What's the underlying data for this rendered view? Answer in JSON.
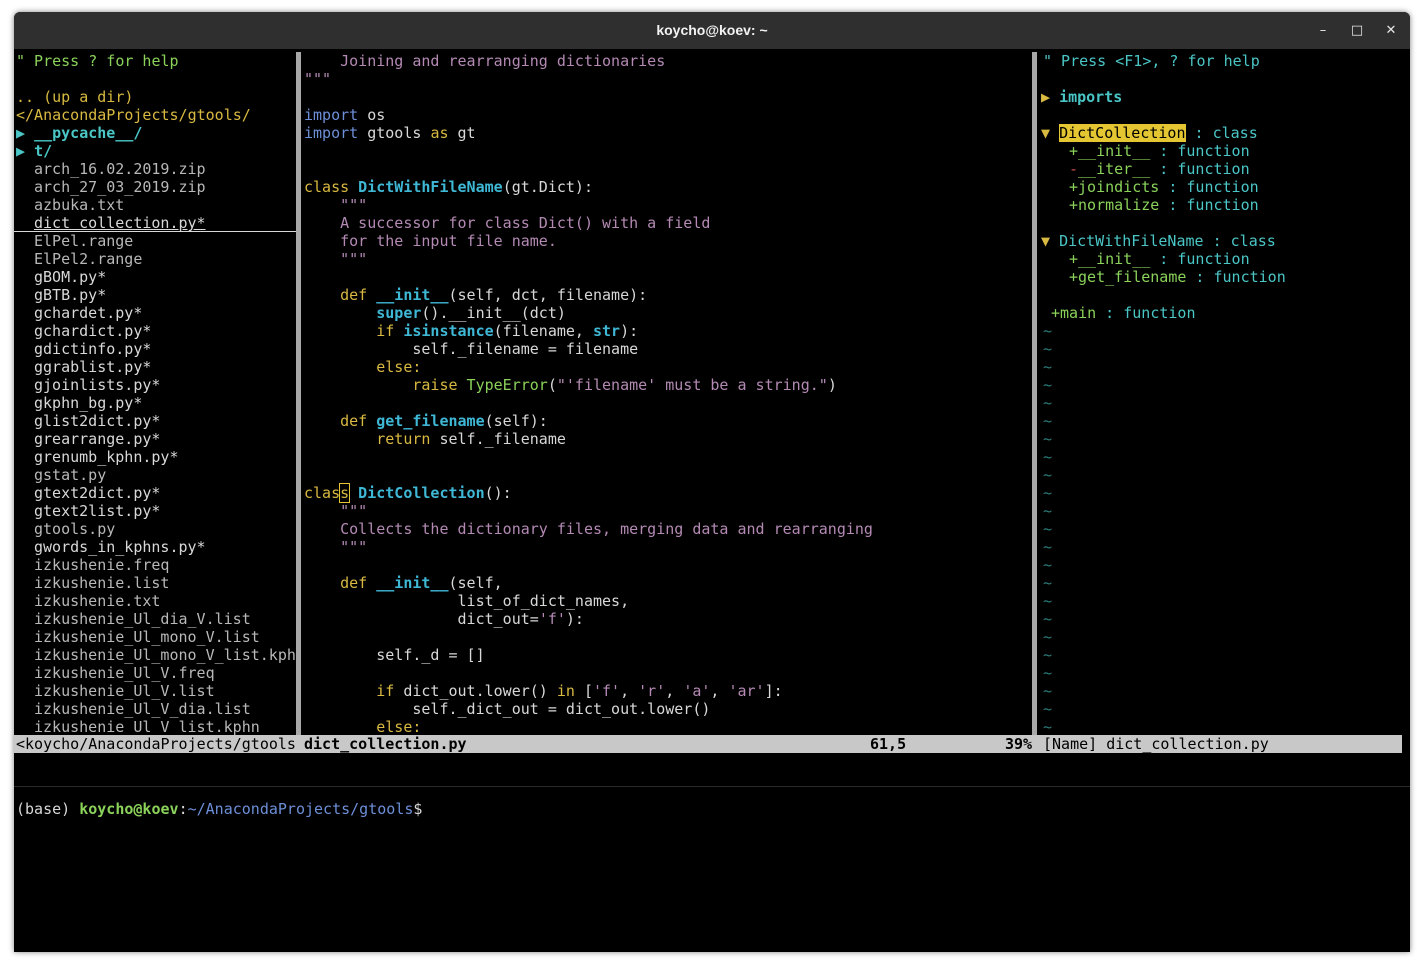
{
  "window": {
    "title": "koycho@koev: ~"
  },
  "left_pane": {
    "help": "\" Press ? for help",
    "updir": ".. (up a dir)",
    "cwd": "</AnacondaProjects/gtools/",
    "dirs": [
      "▶ __pycache__/",
      "▶ t/"
    ],
    "files": [
      {
        "name": "arch_16.02.2019.zip",
        "kind": "plain"
      },
      {
        "name": "arch_27_03_2019.zip",
        "kind": "plain"
      },
      {
        "name": "azbuka.txt",
        "kind": "plain"
      },
      {
        "name": "dict_collection.py*",
        "kind": "exec-current"
      },
      {
        "name": "ElPel.range",
        "kind": "plain"
      },
      {
        "name": "ElPel2.range",
        "kind": "plain"
      },
      {
        "name": "gBOM.py*",
        "kind": "exec"
      },
      {
        "name": "gBTB.py*",
        "kind": "exec"
      },
      {
        "name": "gchardet.py*",
        "kind": "exec"
      },
      {
        "name": "gchardict.py*",
        "kind": "exec"
      },
      {
        "name": "gdictinfo.py*",
        "kind": "exec"
      },
      {
        "name": "ggrablist.py*",
        "kind": "exec"
      },
      {
        "name": "gjoinlists.py*",
        "kind": "exec"
      },
      {
        "name": "gkphn_bg.py*",
        "kind": "exec"
      },
      {
        "name": "glist2dict.py*",
        "kind": "exec"
      },
      {
        "name": "grearrange.py*",
        "kind": "exec"
      },
      {
        "name": "grenumb_kphn.py*",
        "kind": "exec"
      },
      {
        "name": "gstat.py",
        "kind": "plain"
      },
      {
        "name": "gtext2dict.py*",
        "kind": "exec"
      },
      {
        "name": "gtext2list.py*",
        "kind": "exec"
      },
      {
        "name": "gtools.py",
        "kind": "plain"
      },
      {
        "name": "gwords_in_kphns.py*",
        "kind": "exec"
      },
      {
        "name": "izkushenie.freq",
        "kind": "plain"
      },
      {
        "name": "izkushenie.list",
        "kind": "plain"
      },
      {
        "name": "izkushenie.txt",
        "kind": "plain"
      },
      {
        "name": "izkushenie_Ul_dia_V.list",
        "kind": "plain"
      },
      {
        "name": "izkushenie_Ul_mono_V.list",
        "kind": "plain"
      },
      {
        "name": "izkushenie_Ul_mono_V_list.kph",
        "kind": "plain"
      },
      {
        "name": "izkushenie_Ul_V.freq",
        "kind": "plain"
      },
      {
        "name": "izkushenie_Ul_V.list",
        "kind": "plain"
      },
      {
        "name": "izkushenie_Ul_V_dia.list",
        "kind": "plain"
      },
      {
        "name": "izkushenie_Ul_V_list.kphn",
        "kind": "plain"
      }
    ]
  },
  "code": {
    "l1": "    Joining and rearranging dictionaries",
    "l2": "\"\"\"",
    "import1_kw": "import",
    "import1_mod": " os",
    "import2_kw": "import",
    "import2_mod": " gtools ",
    "import2_as": "as",
    "import2_alias": " gt",
    "c1_kw": "class",
    "c1_name": " DictWithFileName",
    "c1_args": "(gt.Dict):",
    "c1_doc1": "    \"\"\"",
    "c1_doc2": "    A successor for class Dict() with a field",
    "c1_doc3": "    for the input file name.",
    "c1_doc4": "    \"\"\"",
    "d1_kw": "    def",
    "d1_name": " __init__",
    "d1_args": "(self, dct, filename):",
    "d1_l1_fn": "        super",
    "d1_l1_rest": "().__init__(dct)",
    "d1_l2_if": "        if",
    "d1_l2_fn": " isinstance",
    "d1_l2_a": "(filename, ",
    "d1_l2_str": "str",
    "d1_l2_b": "):",
    "d1_l3": "            self._filename = filename",
    "d1_l4": "        else:",
    "d1_l5_raise": "            raise",
    "d1_l5_exc": " TypeError",
    "d1_l5_a": "(",
    "d1_l5_str": "\"'filename' must be a string.\"",
    "d1_l5_b": ")",
    "d2_kw": "    def",
    "d2_name": " get_filename",
    "d2_args": "(self):",
    "d2_ret": "        return",
    "d2_rest": " self._filename",
    "c2_kw_a": "clas",
    "c2_kw_b": "s",
    "c2_name": " DictCollection",
    "c2_args": "():",
    "c2_doc1": "    \"\"\"",
    "c2_doc2": "    Collects the dictionary files, merging data and rearranging",
    "c2_doc3": "    \"\"\"",
    "d3_kw": "    def",
    "d3_name": " __init__",
    "d3_args": "(self,",
    "d3_l2": "                 list_of_dict_names,",
    "d3_l3_a": "                 dict_out=",
    "d3_l3_str": "'f'",
    "d3_l3_b": "):",
    "d3_l5": "        self._d = []",
    "d3_l7_if": "        if",
    "d3_l7_a": " dict_out.lower() ",
    "d3_l7_in": "in",
    "d3_l7_b": " [",
    "d3_l7_s1": "'f'",
    "d3_l7_c1": ", ",
    "d3_l7_s2": "'r'",
    "d3_l7_c2": ", ",
    "d3_l7_s3": "'a'",
    "d3_l7_c3": ", ",
    "d3_l7_s4": "'ar'",
    "d3_l7_d": "]:",
    "d3_l8": "            self._dict_out = dict_out.lower()",
    "d3_l9": "        else:"
  },
  "tagbar": {
    "help": "\" Press <F1>, ? for help",
    "imports": "imports",
    "cls1": "DictCollection",
    "cls1_kind": " : class",
    "m1_vis": "+",
    "m1_name": "__init__",
    "m1_kind": " : function",
    "m2_vis": "-",
    "m2_name": "__iter__",
    "m2_kind": " : function",
    "m3_vis": "+",
    "m3_name": "joindicts",
    "m3_kind": " : function",
    "m4_vis": "+",
    "m4_name": "normalize",
    "m4_kind": " : function",
    "cls2": "DictWithFileName",
    "cls2_kind": " : class",
    "m5_vis": "+",
    "m5_name": "__init__",
    "m5_kind": " : function",
    "m6_vis": "+",
    "m6_name": "get_filename",
    "m6_kind": " : function",
    "main_vis": "+",
    "main_name": "main",
    "main_kind": " : function",
    "tilde": "~"
  },
  "status": {
    "left": "<koycho/AnacondaProjects/gtools",
    "file": "dict_collection.py",
    "pos": "61,5",
    "pct": "39%",
    "right": "[Name] dict_collection.py"
  },
  "shell": {
    "env": "(base)",
    "userhost": "koycho@koev",
    "colon": ":",
    "path": "~/AnacondaProjects/gtools",
    "prompt": "$"
  }
}
